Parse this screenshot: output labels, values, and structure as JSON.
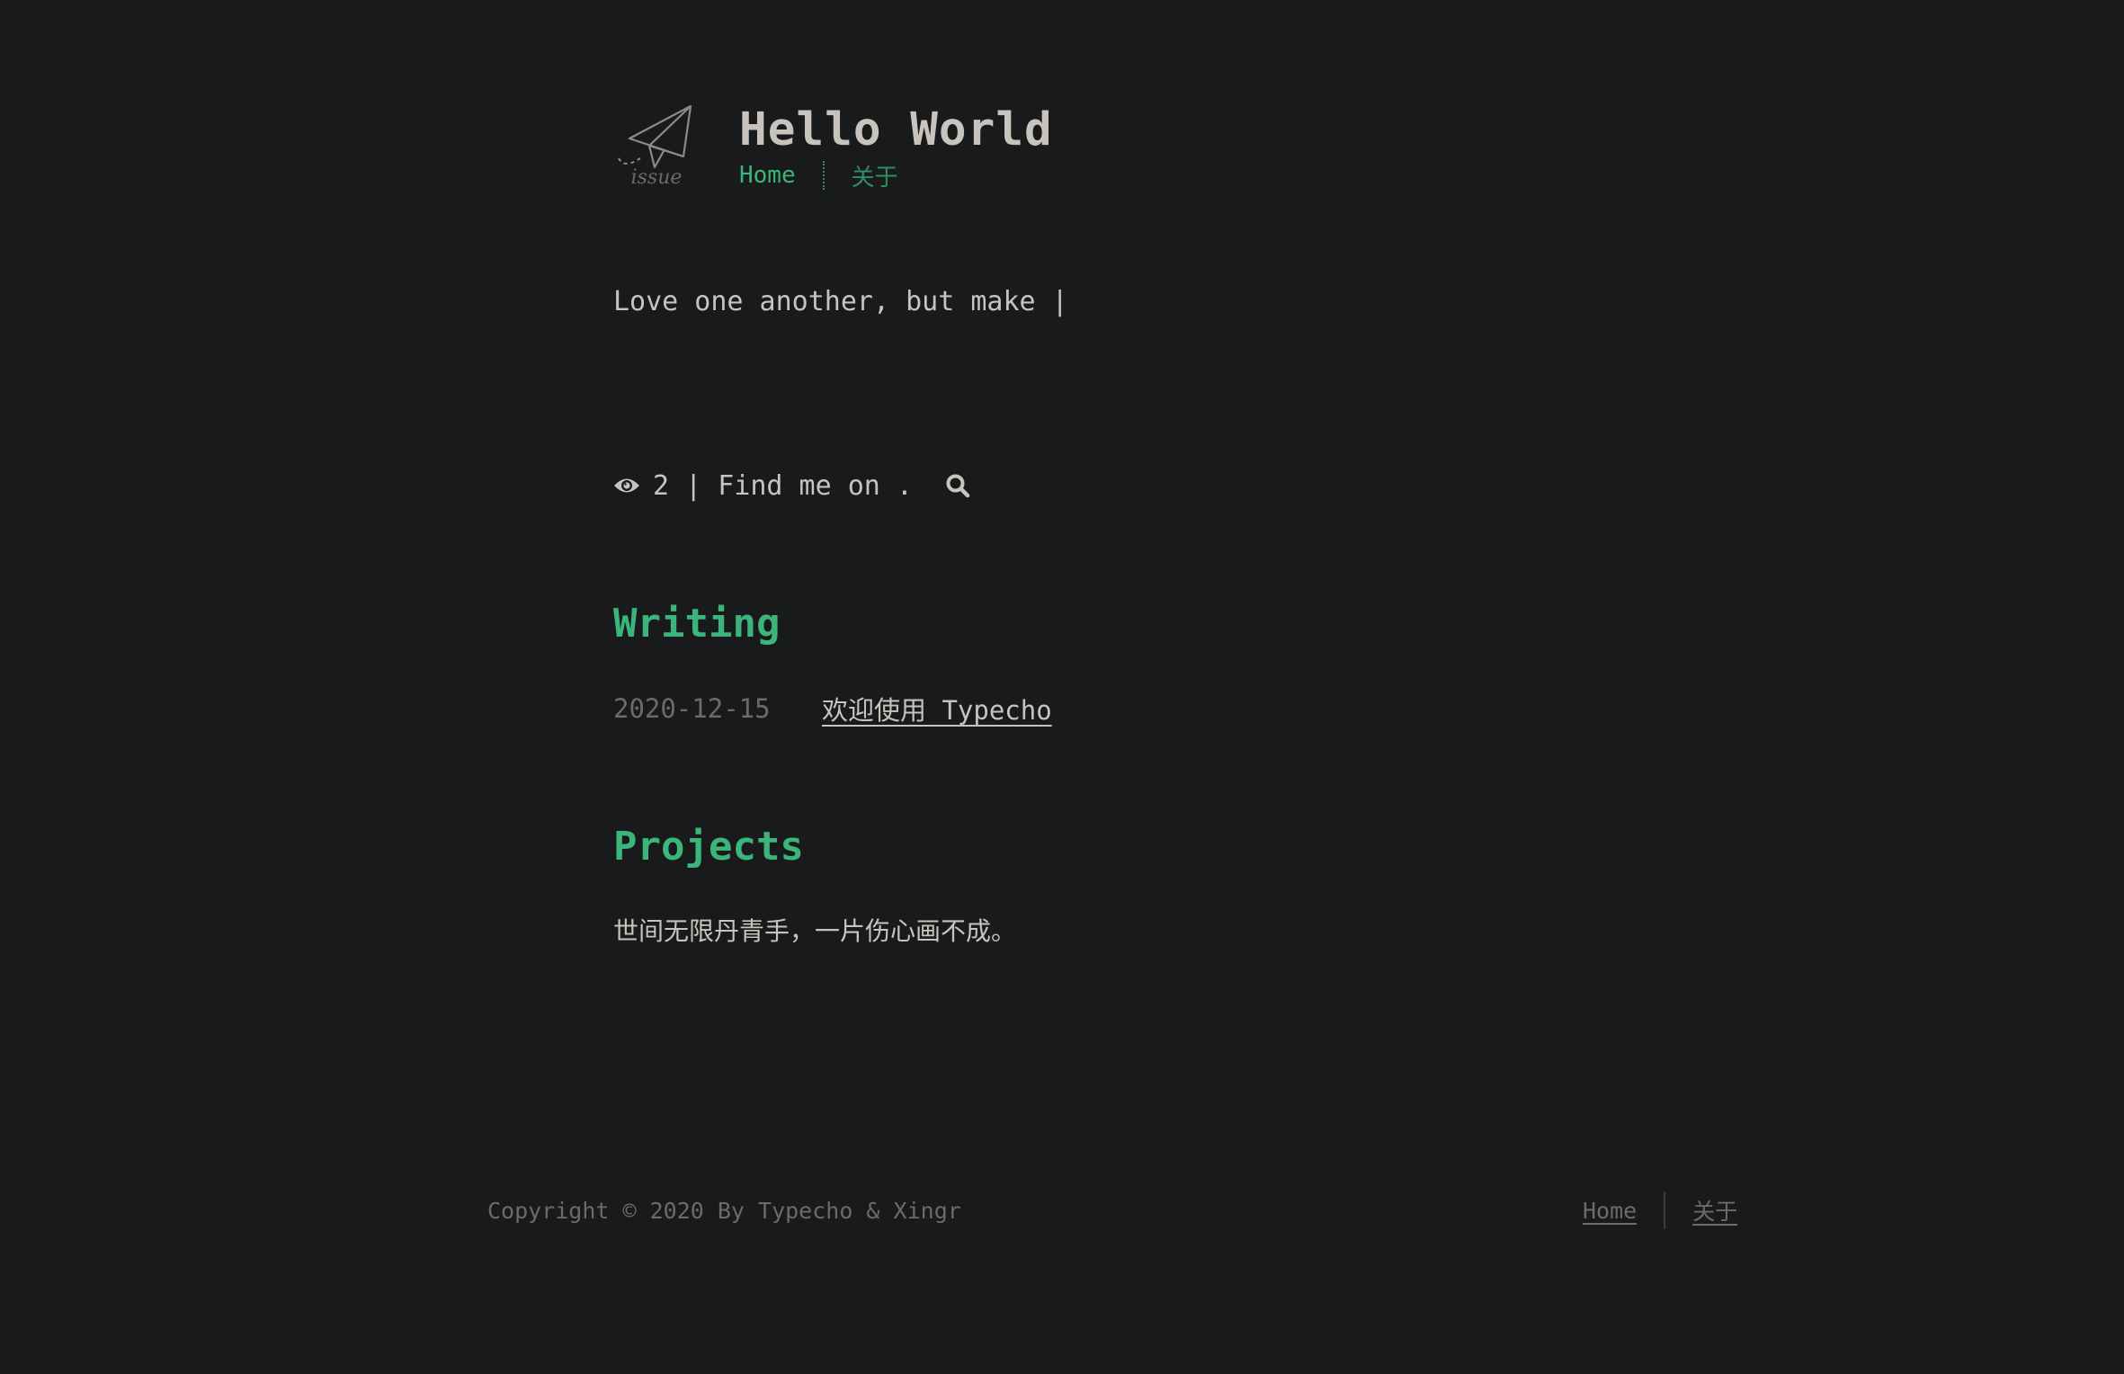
{
  "header": {
    "logo_text": "issue",
    "title": "Hello World",
    "nav": [
      {
        "label": "Home"
      },
      {
        "label": "关于"
      }
    ]
  },
  "intro": {
    "tagline": "Love one another, but make |"
  },
  "meta": {
    "views_icon": "eye-icon",
    "views": "2",
    "find_text": " | Find me on . ",
    "search_icon": "search-icon"
  },
  "writing": {
    "title": "Writing",
    "posts": [
      {
        "date": "2020-12-15",
        "title": "欢迎使用 Typecho"
      }
    ]
  },
  "projects": {
    "title": "Projects",
    "text": "世间无限丹青手，一片伤心画不成。"
  },
  "footer": {
    "copyright": "Copyright © 2020 By Typecho & Xingr",
    "nav": [
      {
        "label": "Home"
      },
      {
        "label": "关于"
      }
    ]
  },
  "colors": {
    "background": "#181a1b",
    "accent": "#3bb57a",
    "text": "#c8c3bc",
    "muted": "#6f6a63"
  }
}
